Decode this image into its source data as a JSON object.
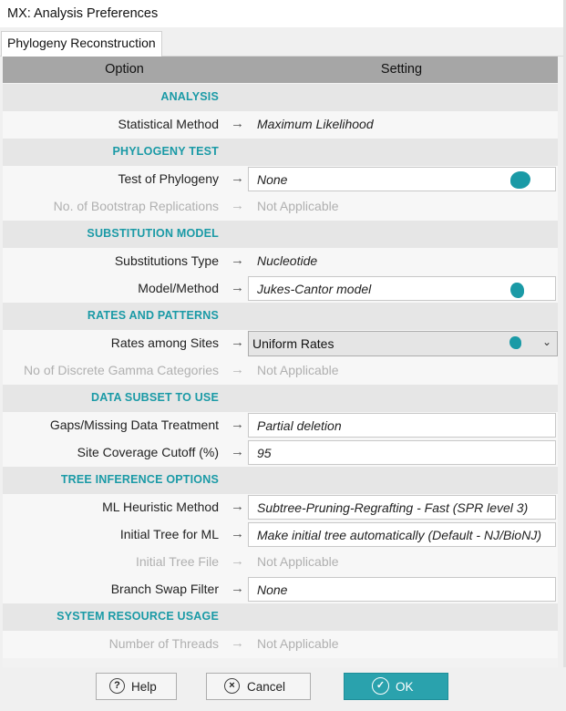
{
  "window": {
    "title": "MX: Analysis Preferences"
  },
  "tabs": [
    {
      "label": "Phylogeny Reconstruction"
    }
  ],
  "header": {
    "option": "Option",
    "setting": "Setting"
  },
  "sections": {
    "analysis": "ANALYSIS",
    "phylogeny_test": "PHYLOGENY TEST",
    "substitution_model": "SUBSTITUTION MODEL",
    "rates_patterns": "RATES AND PATTERNS",
    "data_subset": "DATA SUBSET TO USE",
    "tree_inference": "TREE INFERENCE OPTIONS",
    "system_resource": "SYSTEM RESOURCE USAGE"
  },
  "options": {
    "statistical_method": {
      "label": "Statistical Method",
      "value": "Maximum Likelihood"
    },
    "test_of_phylogeny": {
      "label": "Test of Phylogeny",
      "value": "None"
    },
    "bootstrap_replications": {
      "label": "No. of Bootstrap Replications",
      "value": "Not Applicable"
    },
    "substitutions_type": {
      "label": "Substitutions Type",
      "value": "Nucleotide"
    },
    "model_method": {
      "label": "Model/Method",
      "value": "Jukes-Cantor model"
    },
    "rates_among_sites": {
      "label": "Rates among Sites",
      "value": "Uniform Rates"
    },
    "gamma_categories": {
      "label": "No of Discrete Gamma Categories",
      "value": "Not Applicable"
    },
    "gaps_missing": {
      "label": "Gaps/Missing Data Treatment",
      "value": "Partial deletion"
    },
    "site_coverage": {
      "label": "Site Coverage Cutoff (%)",
      "value": "95"
    },
    "ml_heuristic": {
      "label": "ML Heuristic Method",
      "value": "Subtree-Pruning-Regrafting - Fast (SPR level 3)"
    },
    "initial_tree_ml": {
      "label": "Initial Tree for ML",
      "value": "Make initial tree automatically (Default - NJ/BioNJ)"
    },
    "initial_tree_file": {
      "label": "Initial Tree File",
      "value": "Not Applicable"
    },
    "branch_swap": {
      "label": "Branch Swap Filter",
      "value": "None"
    },
    "threads": {
      "label": "Number of Threads",
      "value": "Not Applicable"
    }
  },
  "arrow_glyph": "→",
  "buttons": {
    "help": "Help",
    "cancel": "Cancel",
    "ok": "OK"
  },
  "colors": {
    "accent": "#1a9aa6",
    "header_bg": "#a6a6a6",
    "ok_bg": "#2aa2ad"
  }
}
